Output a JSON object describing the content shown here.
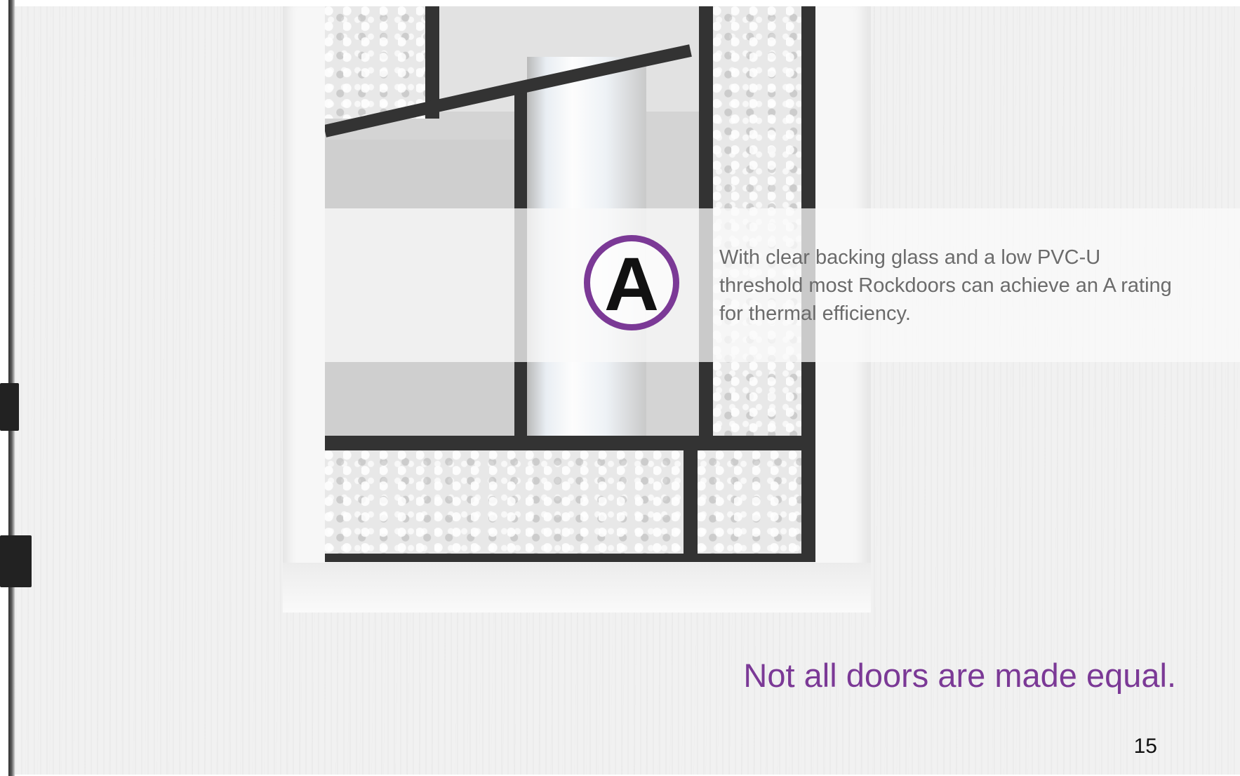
{
  "rating_badge": {
    "letter": "A",
    "ring_color": "#7b3996"
  },
  "info": {
    "text": "With clear backing glass and a low PVC-U threshold most Rockdoors can achieve an A rating for thermal efficiency."
  },
  "tagline": {
    "text": "Not all doors are made equal.",
    "color": "#7b3996"
  },
  "page_number": "15"
}
